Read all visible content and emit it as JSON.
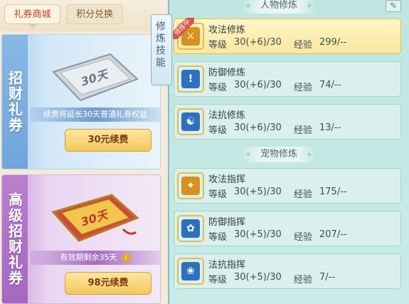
{
  "tabs": [
    "礼券商城",
    "积分兑换"
  ],
  "side_tab": "修炼技能",
  "coupons": [
    {
      "label": "招财礼券",
      "ticket_text": "30天",
      "info": "续费将延长30天普通礼券权益",
      "button": "30元续费",
      "has_info_icon": false
    },
    {
      "label": "高级招财礼券",
      "ticket_text": "30天",
      "info": "有效期剩余35天",
      "button": "98元续费",
      "has_info_icon": true
    }
  ],
  "info_icon": "i",
  "sections": {
    "character": "人物修炼",
    "pet": "宠物修炼"
  },
  "level_label": "等级",
  "exp_label": "经验",
  "character_skills": [
    {
      "name": "攻法修炼",
      "level": "30(+6)/30",
      "exp": "299/--",
      "active": true,
      "tag": "修炼中",
      "icon": "sword-icon",
      "color": "#d9901e"
    },
    {
      "name": "防御修炼",
      "level": "30(+6)/30",
      "exp": "74/--",
      "active": false,
      "icon": "shield-icon",
      "color": "#2f6fbf"
    },
    {
      "name": "法抗修炼",
      "level": "30(+6)/30",
      "exp": "13/--",
      "active": false,
      "icon": "taiji-icon",
      "color": "#2f6fbf"
    }
  ],
  "pet_skills": [
    {
      "name": "攻法指挥",
      "level": "30(+5)/30",
      "exp": "175/--",
      "icon": "paw-attack-icon",
      "color": "#d9901e"
    },
    {
      "name": "防御指挥",
      "level": "30(+5)/30",
      "exp": "207/--",
      "icon": "paw-defense-icon",
      "color": "#2f6fbf"
    },
    {
      "name": "法抗指挥",
      "level": "30(+5)/30",
      "exp": "7/--",
      "icon": "paw-resist-icon",
      "color": "#2f6fbf"
    }
  ]
}
